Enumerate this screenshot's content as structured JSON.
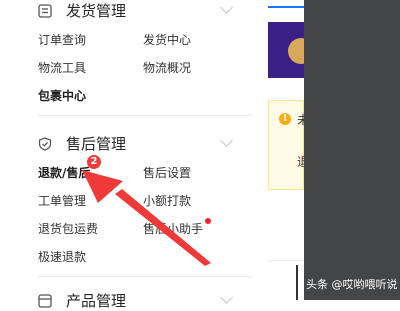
{
  "sidebar": {
    "sections": [
      {
        "title": "发货管理",
        "icon": "document-list-icon",
        "items": [
          "订单查询",
          "发货中心",
          "物流工具",
          "物流概况",
          "包裹中心"
        ]
      },
      {
        "title": "售后管理",
        "icon": "shield-check-icon",
        "items": [
          "退款/售后",
          "售后设置",
          "工单管理",
          "小额打款",
          "退货包运费",
          "售后小助手",
          "极速退款"
        ],
        "badge": "2"
      },
      {
        "title": "产品管理",
        "icon": "product-box-icon"
      }
    ]
  },
  "right_panel": {
    "notice_line1": "未",
    "notice_line2": "退"
  },
  "watermark": "头条 @哎哟喂听说",
  "colors": {
    "accent_red": "#f23c3c",
    "arrow_red": "#f03a3a",
    "brand_blue": "#1677ff",
    "warning": "#faad14",
    "overlay_dark": "#444546"
  }
}
